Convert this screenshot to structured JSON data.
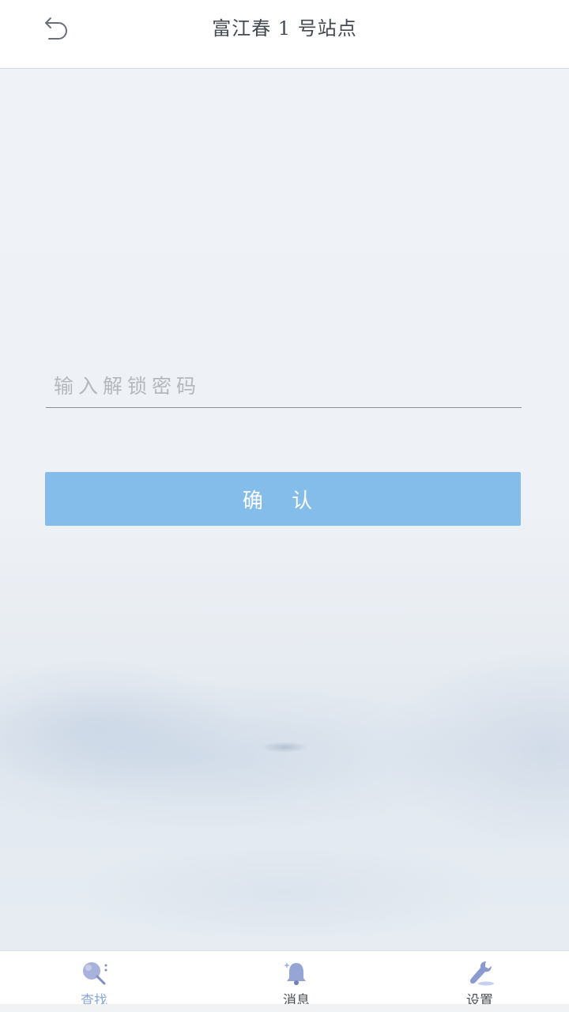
{
  "header": {
    "back_icon": "undo-arrow-icon",
    "title": "富江春 1 号站点"
  },
  "form": {
    "password_placeholder": "输入解锁密码",
    "password_value": "",
    "confirm_label": "确 认"
  },
  "tabbar": {
    "tabs": [
      {
        "label": "查找",
        "icon": "search-icon",
        "active": true
      },
      {
        "label": "消息",
        "icon": "bell-icon",
        "active": false
      },
      {
        "label": "设置",
        "icon": "wrench-icon",
        "active": false
      }
    ]
  },
  "colors": {
    "accent": "#84bdea",
    "active_tab": "#8aa6dc",
    "icon": "#7f8fc6"
  }
}
